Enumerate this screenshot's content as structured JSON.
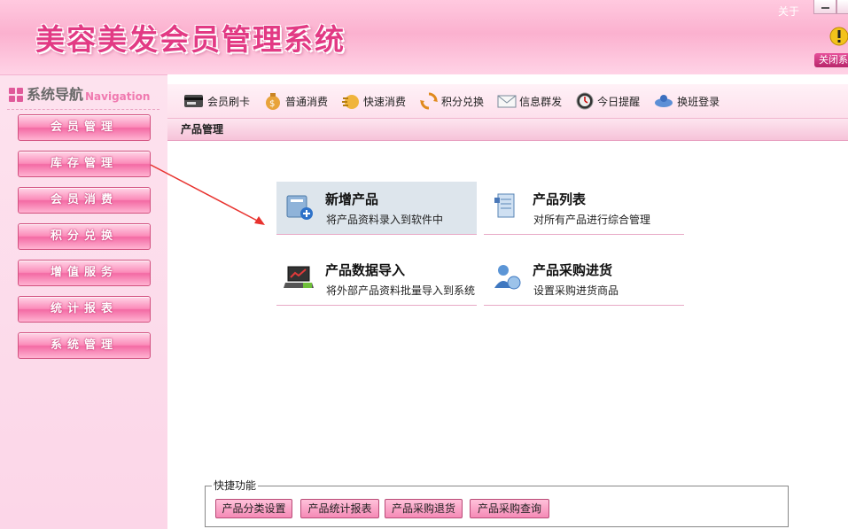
{
  "header": {
    "app_title": "美容美发会员管理系统",
    "about": "关于",
    "close_system": "关闭系"
  },
  "sidebar": {
    "title": "系统导航",
    "title_en": "Navigation",
    "items": [
      {
        "label": "会员管理"
      },
      {
        "label": "库存管理"
      },
      {
        "label": "会员消费"
      },
      {
        "label": "积分兑换"
      },
      {
        "label": "增值服务"
      },
      {
        "label": "统计报表"
      },
      {
        "label": "系统管理"
      }
    ]
  },
  "toolbar": {
    "items": [
      {
        "label": "会员刷卡",
        "icon": "card-reader-icon"
      },
      {
        "label": "普通消费",
        "icon": "money-bag-icon"
      },
      {
        "label": "快速消费",
        "icon": "fast-money-icon"
      },
      {
        "label": "积分兑换",
        "icon": "exchange-icon"
      },
      {
        "label": "信息群发",
        "icon": "mail-icon"
      },
      {
        "label": "今日提醒",
        "icon": "clock-icon"
      },
      {
        "label": "换班登录",
        "icon": "switch-user-icon"
      }
    ]
  },
  "section": {
    "title": "产品管理"
  },
  "features": [
    {
      "title": "新增产品",
      "desc": "将产品资料录入到软件中",
      "icon": "add-product-icon"
    },
    {
      "title": "产品列表",
      "desc": "对所有产品进行综合管理",
      "icon": "product-list-icon"
    },
    {
      "title": "产品数据导入",
      "desc": "将外部产品资料批量导入到系统",
      "icon": "import-laptop-icon"
    },
    {
      "title": "产品采购进货",
      "desc": "设置采购进货商品",
      "icon": "purchase-user-icon"
    }
  ],
  "quick": {
    "legend": "快捷功能",
    "buttons": [
      {
        "label": "产品分类设置"
      },
      {
        "label": "产品统计报表"
      },
      {
        "label": "产品采购退货"
      },
      {
        "label": "产品采购查询"
      }
    ]
  },
  "colors": {
    "accent": "#e23a84",
    "nav_button": "#f36aa4",
    "highlight": "#dde5ec"
  }
}
